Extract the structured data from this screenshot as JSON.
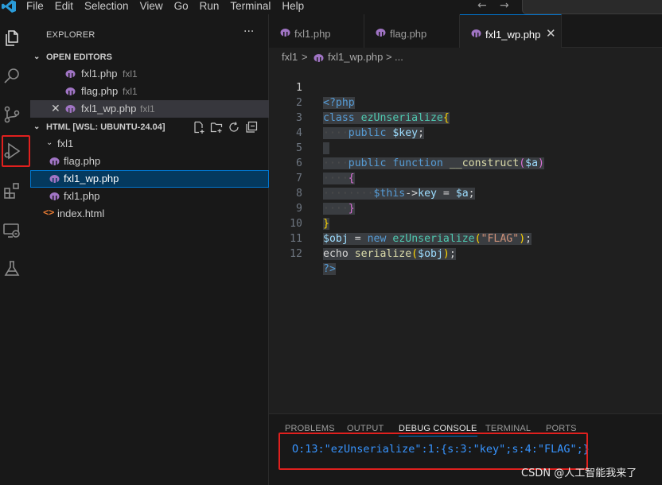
{
  "menu": [
    "File",
    "Edit",
    "Selection",
    "View",
    "Go",
    "Run",
    "Terminal",
    "Help"
  ],
  "sidebar": {
    "title": "EXPLORER",
    "more": "···",
    "open_editors": {
      "label": "OPEN EDITORS",
      "items": [
        {
          "name": "fxl1.php",
          "desc": "fxl1"
        },
        {
          "name": "flag.php",
          "desc": "fxl1"
        },
        {
          "name": "fxl1_wp.php",
          "desc": "fxl1"
        }
      ]
    },
    "workspace": {
      "label": "HTML [WSL: UBUNTU-24.04]",
      "folder": "fxl1",
      "files": [
        "flag.php",
        "fxl1_wp.php",
        "fxl1.php"
      ],
      "root_file": "index.html"
    }
  },
  "tabs": [
    {
      "label": "fxl1.php"
    },
    {
      "label": "flag.php"
    },
    {
      "label": "fxl1_wp.php",
      "close": "✕"
    }
  ],
  "breadcrumb": {
    "folder": "fxl1",
    "sep": ">",
    "file": "fxl1_wp.php",
    "sep2": ">",
    "more": "..."
  },
  "editor": {
    "line_numbers": [
      "1",
      "2",
      "3",
      "4",
      "5",
      "6",
      "7",
      "8",
      "9",
      "10",
      "11",
      "12"
    ],
    "lines": [
      "<?php",
      "class ezUnserialize{",
      "    public $key;",
      "",
      "    public function __construct($a)",
      "    {",
      "        $this->key = $a;",
      "    }",
      "}",
      "$obj = new ezUnserialize(\"FLAG\");",
      "echo serialize($obj);",
      "?>"
    ]
  },
  "panel": {
    "tabs": [
      "PROBLEMS",
      "OUTPUT",
      "DEBUG CONSOLE",
      "TERMINAL",
      "PORTS"
    ],
    "output": "O:13:\"ezUnserialize\":1:{s:3:\"key\";s:4:\"FLAG\";}"
  },
  "watermark": "CSDN @人工智能我来了",
  "colors": {
    "accent": "#0078d4",
    "annotation": "#e0201e",
    "php_icon": "#a074c4"
  }
}
